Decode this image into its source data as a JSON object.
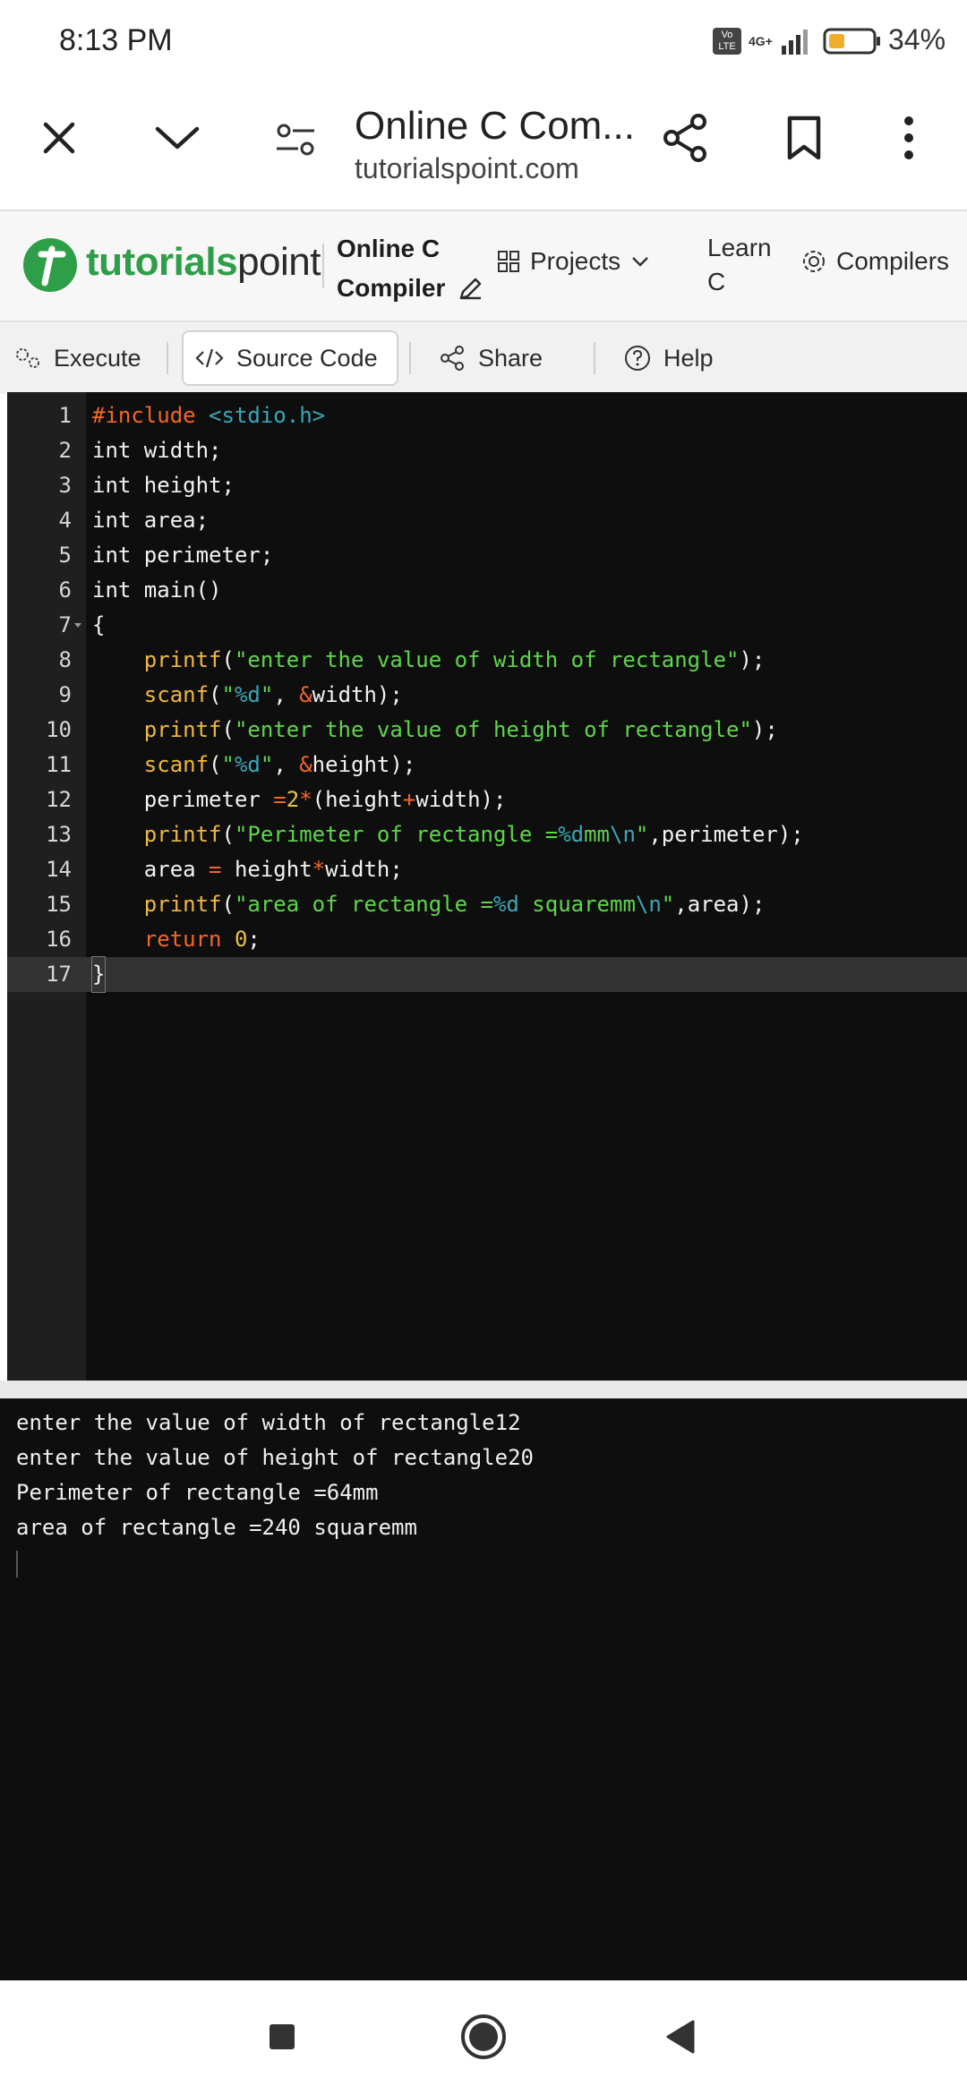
{
  "status_bar": {
    "time": "8:13 PM",
    "network": "4G+",
    "volte": "Vo LTE",
    "battery": "34%"
  },
  "browser": {
    "title": "Online C Com...",
    "url": "tutorialspoint.com"
  },
  "site": {
    "logo_bold": "tutorials",
    "logo_light": "point",
    "page_title_line1": "Online C",
    "page_title_line2": "Compiler",
    "projects": "Projects",
    "learn_line1": "Learn",
    "learn_line2": "C",
    "compilers": "Compilers"
  },
  "toolbar": {
    "execute": "Execute",
    "source_code": "Source Code",
    "share": "Share",
    "help": "Help"
  },
  "editor": {
    "line_numbers": [
      "1",
      "2",
      "3",
      "4",
      "5",
      "6",
      "7",
      "8",
      "9",
      "10",
      "11",
      "12",
      "13",
      "14",
      "15",
      "16",
      "17"
    ],
    "l1a": "#include",
    "l1b": " <stdio.h>",
    "l2": "int width;",
    "l3": "int height;",
    "l4": "int area;",
    "l5": "int perimeter;",
    "l6": "int main()",
    "l7": "{",
    "l8_fn": "printf",
    "l8_p": "(",
    "l8_s": "\"enter the value of width of rectangle\"",
    "l8_e": ");",
    "l9_fn": "scanf",
    "l9_p": "(",
    "l9_s1": "\"",
    "l9_fmt": "%d",
    "l9_s2": "\"",
    "l9_c": ", ",
    "l9_amp": "&",
    "l9_e": "width);",
    "l10_fn": "printf",
    "l10_p": "(",
    "l10_s": "\"enter the value of height of rectangle\"",
    "l10_e": ");",
    "l11_fn": "scanf",
    "l11_p": "(",
    "l11_s1": "\"",
    "l11_fmt": "%d",
    "l11_s2": "\"",
    "l11_c": ", ",
    "l11_amp": "&",
    "l11_e": "height);",
    "l12_a": "perimeter ",
    "l12_eq": "=",
    "l12_n": "2",
    "l12_st": "*",
    "l12_b": "(height",
    "l12_pl": "+",
    "l12_c": "width);",
    "l13_fn": "printf",
    "l13_p": "(",
    "l13_s1": "\"Perimeter of rectangle =",
    "l13_fmt": "%d",
    "l13_s2": "mm",
    "l13_esc": "\\n",
    "l13_s3": "\"",
    "l13_e": ",perimeter);",
    "l14_a": "area ",
    "l14_eq": "=",
    "l14_b": " height",
    "l14_st": "*",
    "l14_c": "width;",
    "l15_fn": "printf",
    "l15_p": "(",
    "l15_s1": "\"area of rectangle =",
    "l15_fmt": "%d",
    "l15_s2": " squaremm",
    "l15_esc": "\\n",
    "l15_s3": "\"",
    "l15_e": ",area);",
    "l16_kw": "return",
    "l16_sp": " ",
    "l16_n": "0",
    "l16_e": ";",
    "l17": "}"
  },
  "output": {
    "lines": [
      "enter the value of width of rectangle12",
      "enter the value of height of rectangle20",
      "Perimeter of rectangle =64mm",
      "area of rectangle =240 squaremm"
    ]
  },
  "colors": {
    "brand_green": "#2e9e48",
    "editor_bg": "#0e0e0e",
    "gutter_bg": "#1f1f1f",
    "string": "#5ed64a",
    "function": "#f0b83c",
    "keyword": "#f2662b"
  }
}
